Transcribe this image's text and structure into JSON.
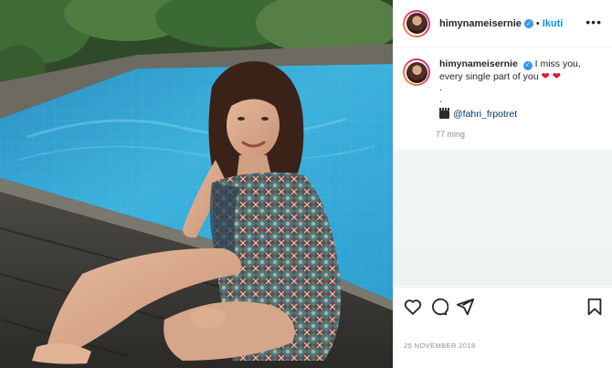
{
  "post": {
    "username": "himynameisernie",
    "verified_mark": "✓",
    "separator": "•",
    "follow_label": "Ikuti",
    "more_label": "•••",
    "caption_text": "I miss you, every single part of you",
    "caption_hearts": "❤ ❤",
    "caption_dot_1": ".",
    "caption_dot_2": ".",
    "credit_icon": "clapperboard-icon",
    "credit_mention": "@fahri_frpotret",
    "time_ago": "77 ming",
    "date": "25 NOVEMBER 2018"
  },
  "actions": {
    "like_icon": "heart-outline-icon",
    "comment_icon": "comment-bubble-icon",
    "share_icon": "paper-plane-icon",
    "save_icon": "bookmark-icon"
  },
  "colors": {
    "follow_blue": "#0095f6",
    "verified_blue": "#3897f0",
    "heart_red": "#e0162b",
    "pool_water": "#3aa9d6"
  }
}
